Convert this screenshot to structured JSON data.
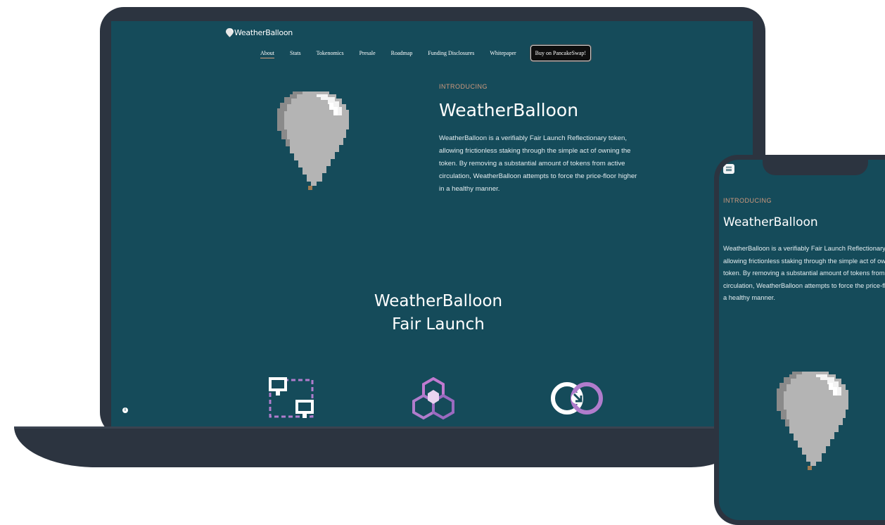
{
  "laptop": {
    "logo_text": "WeatherBalloon",
    "nav": [
      {
        "label": "About",
        "active": true
      },
      {
        "label": "Stats"
      },
      {
        "label": "Tokenomics"
      },
      {
        "label": "Presale"
      },
      {
        "label": "Roadmap"
      },
      {
        "label": "Funding Disclosures"
      },
      {
        "label": "Whitepaper"
      }
    ],
    "buy_button": "Buy on PancakeSwap!",
    "intro": {
      "kicker": "INTRODUCING",
      "title": "WeatherBalloon",
      "text": "WeatherBalloon is a verifiably Fair Launch Reflectionary token, allowing frictionless staking through the simple act of owning the token. By removing a substantial amount of tokens from active circulation, WeatherBalloon attempts to force the price-floor higher in a healthy manner."
    },
    "fair_launch": {
      "line1": "WeatherBalloon",
      "line2": "Fair Launch"
    },
    "features": [
      {
        "icon": "transfer-screens-icon"
      },
      {
        "icon": "hexagon-network-icon"
      },
      {
        "icon": "rotate-arrow-icon"
      }
    ],
    "info_dot": "i"
  },
  "phone": {
    "intro": {
      "kicker": "INTRODUCING",
      "title": "WeatherBalloon",
      "text": "WeatherBalloon is a verifiably Fair Launch Reflectionary token, allowing frictionless staking through the simple act of owning the token. By removing a substantial amount of tokens from active circulation, WeatherBalloon attempts to force the price-floor higher in a healthy manner."
    }
  },
  "colors": {
    "bg": "#154b5a",
    "device": "#2c3440",
    "accent": "#d09a7e",
    "icon_purple": "#b07ccc"
  }
}
